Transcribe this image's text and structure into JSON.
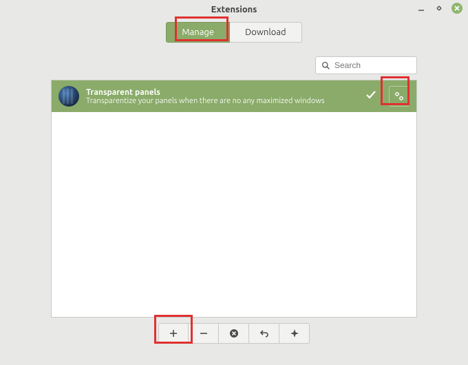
{
  "window": {
    "title": "Extensions"
  },
  "tabs": {
    "manage": "Manage",
    "download": "Download",
    "active": "manage"
  },
  "search": {
    "placeholder": "Search"
  },
  "extension": {
    "title": "Transparent panels",
    "description": "Transparentize your panels when there are no any maximized windows"
  },
  "toolbar": {
    "add": "add",
    "remove": "remove",
    "disable": "disable",
    "undo": "undo",
    "info": "info"
  },
  "highlights": [
    {
      "target": "manage-tab"
    },
    {
      "target": "settings-button"
    },
    {
      "target": "add-button"
    }
  ]
}
